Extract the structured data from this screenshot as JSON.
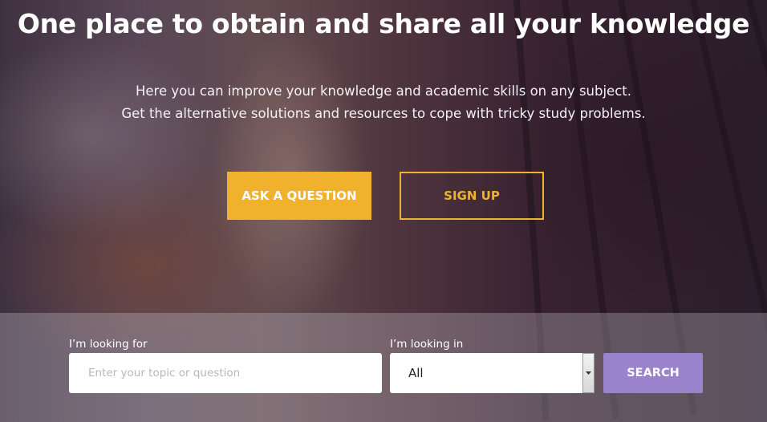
{
  "hero": {
    "title": "One place to obtain and share all your knowledge",
    "subtitle_line1": "Here you can improve your knowledge and academic skills on any subject.",
    "subtitle_line2": "Get the alternative solutions and resources to cope with tricky study problems.",
    "ask_button": "ASK A QUESTION",
    "signup_button": "SIGN UP"
  },
  "search": {
    "looking_for_label": "I’m looking for",
    "topic_placeholder": "Enter your topic or question",
    "topic_value": "",
    "looking_in_label": "I’m looking in",
    "category_selected": "All",
    "search_button": "SEARCH"
  },
  "colors": {
    "accent_yellow": "#f0b22d",
    "search_purple": "#9b82cc"
  }
}
